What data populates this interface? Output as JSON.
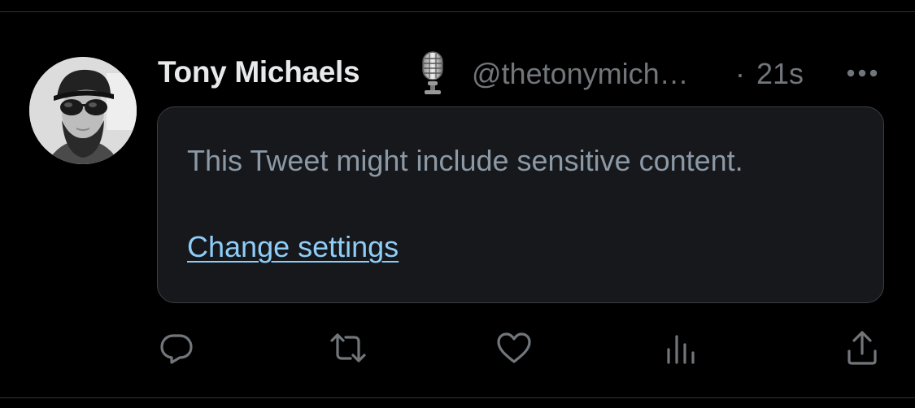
{
  "tweet": {
    "author": {
      "display_name": "Tony Michaels",
      "badge_icon": "microphone-icon",
      "handle": "@thetonymich…",
      "avatar_icon": "profile-avatar"
    },
    "separator": "·",
    "timestamp": "21s",
    "more_icon": "more-options-icon",
    "sensitive_notice": {
      "text": "This Tweet might include sensitive content.",
      "link_label": "Change settings"
    },
    "actions": [
      {
        "name": "reply",
        "icon": "reply-icon"
      },
      {
        "name": "retweet",
        "icon": "retweet-icon"
      },
      {
        "name": "like",
        "icon": "like-icon"
      },
      {
        "name": "analytics",
        "icon": "analytics-icon"
      },
      {
        "name": "share",
        "icon": "share-icon"
      }
    ]
  },
  "colors": {
    "background": "#000000",
    "primary_text": "#e7e9ea",
    "secondary_text": "#71767b",
    "notice_text": "#8b98a5",
    "link": "#8ecdf8",
    "box_background": "#16181c",
    "box_border": "#3b3f43",
    "icon": "#71767b"
  }
}
